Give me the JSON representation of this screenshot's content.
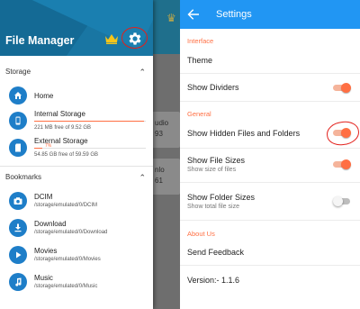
{
  "colors": {
    "accent": "#ff6f43",
    "primary": "#2196f3",
    "drawer_header": "#1976a3",
    "annotation": "#e3201b"
  },
  "drawer": {
    "title": "File Manager",
    "crown_icon": "crown-icon",
    "settings_icon": "gear-icon",
    "storage_section": {
      "label": "Storage",
      "items": [
        {
          "icon": "home-icon",
          "title": "Home"
        },
        {
          "icon": "phone-storage-icon",
          "title": "Internal Storage",
          "detail": "221 MB free of 9.52 GB",
          "used_fraction": 0.98
        },
        {
          "icon": "sd-card-icon",
          "title": "External Storage",
          "detail": "54.85 GB free of 59.59 GB",
          "percent": "7%",
          "used_fraction": 0.07
        }
      ]
    },
    "bookmarks_section": {
      "label": "Bookmarks",
      "items": [
        {
          "icon": "camera-icon",
          "title": "DCIM",
          "path": "/storage/emulated/0/DCIM"
        },
        {
          "icon": "download-icon",
          "title": "Download",
          "path": "/storage/emulated/0/Download"
        },
        {
          "icon": "play-icon",
          "title": "Movies",
          "path": "/storage/emulated/0/Movies"
        },
        {
          "icon": "music-icon",
          "title": "Music",
          "path": "/storage/emulated/0/Music"
        }
      ]
    }
  },
  "background_fragments": {
    "card1": "udio",
    "card1b": "93",
    "card2": "nlo",
    "card2b": "61"
  },
  "settings": {
    "title": "Settings",
    "categories": {
      "interface": "Interface",
      "general": "General",
      "about": "About Us"
    },
    "prefs": {
      "theme": {
        "title": "Theme"
      },
      "show_dividers": {
        "title": "Show Dividers",
        "on": true
      },
      "show_hidden": {
        "title": "Show Hidden Files and Folders",
        "on": true
      },
      "show_file_sizes": {
        "title": "Show File Sizes",
        "summary": "Show size of files",
        "on": true
      },
      "show_folder_sizes": {
        "title": "Show Folder Sizes",
        "summary": "Show total file size",
        "on": false
      },
      "send_feedback": {
        "title": "Send Feedback"
      },
      "version": {
        "title": "Version:- 1.1.6"
      }
    }
  }
}
